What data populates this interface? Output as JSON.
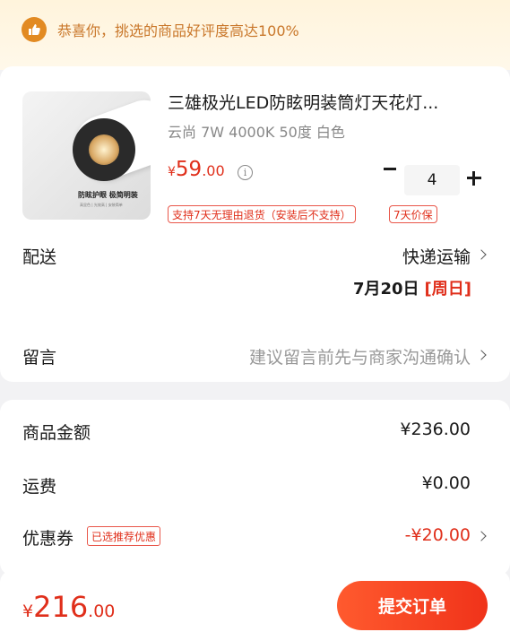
{
  "banner": {
    "icon": "thumbs-up-icon",
    "text": "恭喜你，挑选的商品好评度高达100%"
  },
  "product": {
    "title": "三雄极光LED防眩明装筒灯天花灯...",
    "spec": "云尚 7W 4000K 50度 白色",
    "price_symbol": "¥",
    "price_int": "59",
    "price_dec": ".00",
    "quantity": "4",
    "tags": [
      "支持7天无理由退货（安装后不支持）",
      "7天价保"
    ],
    "image_caption": "防眩护眼 极简明装",
    "image_subcaption": "高显色 | 光效高 | 安装简单"
  },
  "shipping": {
    "label": "配送",
    "method": "快递运输",
    "date": "7月20日",
    "weekday": "[周日]"
  },
  "message": {
    "label": "留言",
    "placeholder": "建议留言前先与商家沟通确认"
  },
  "summary": {
    "goods_label": "商品金额",
    "goods_value": "¥236.00",
    "freight_label": "运费",
    "freight_value": "¥0.00",
    "coupon_label": "优惠券",
    "coupon_badge": "已选推荐优惠",
    "coupon_value": "-¥20.00"
  },
  "footer": {
    "total_symbol": "¥",
    "total_int": "216",
    "total_dec": ".00",
    "submit_label": "提交订单"
  },
  "colors": {
    "accent": "#e02f1b",
    "banner_text": "#c9772a",
    "button": "#f0331a"
  }
}
